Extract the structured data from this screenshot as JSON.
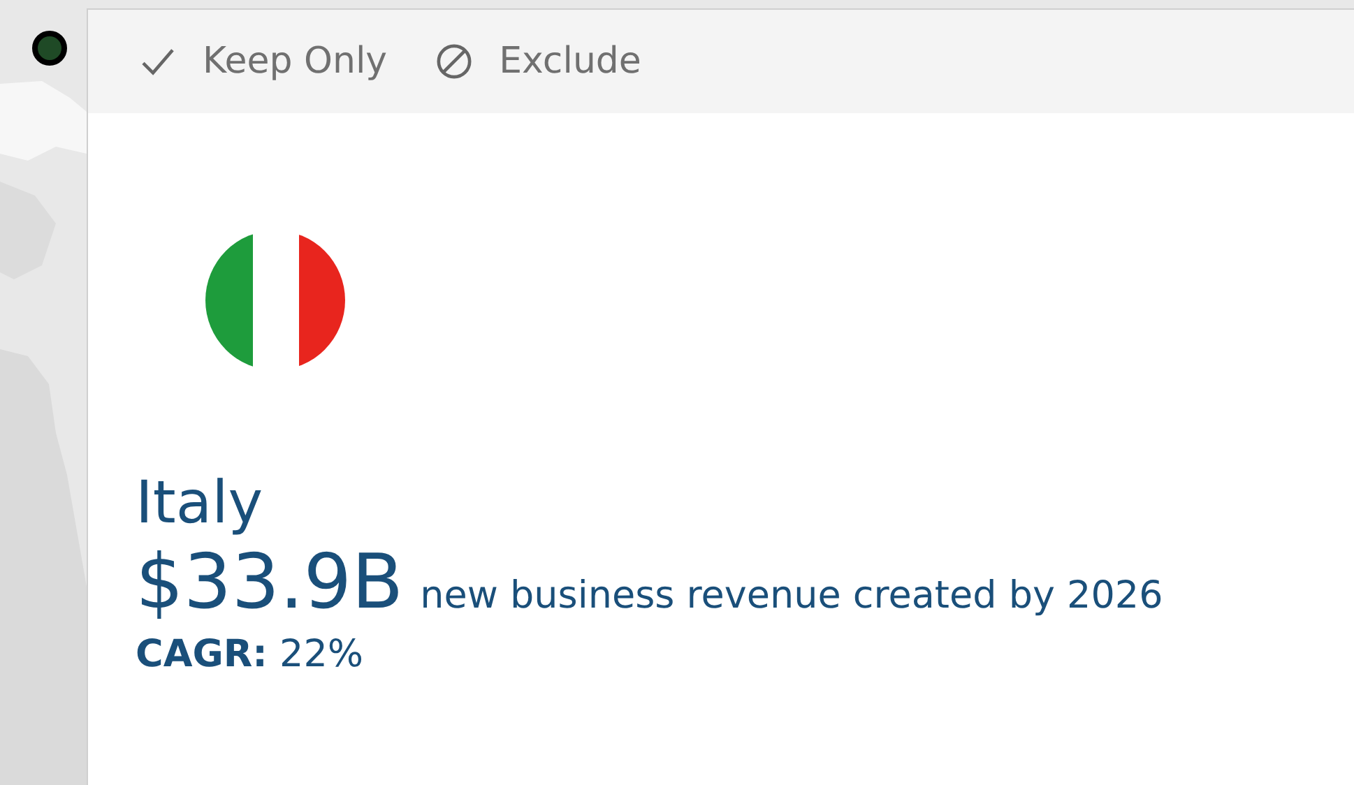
{
  "tooltip": {
    "actions": [
      {
        "kind": "keep",
        "label": "Keep Only"
      },
      {
        "kind": "exclude",
        "label": "Exclude"
      }
    ],
    "country": "Italy",
    "value": "$33.9B",
    "value_caption": "new business revenue created by 2026",
    "cagr": "**CAGR:** 22%"
  }
}
